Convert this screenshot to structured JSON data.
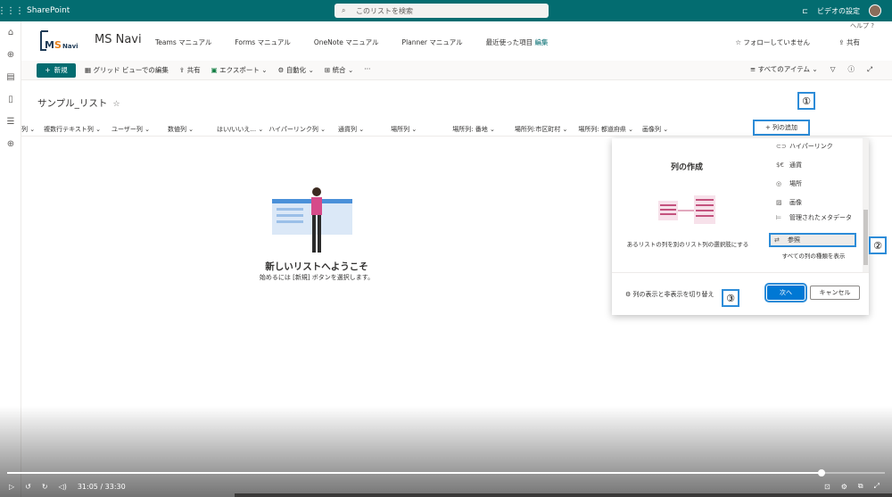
{
  "suite": {
    "app_name": "SharePoint",
    "search_placeholder": "このリストを検索",
    "video_settings": "ビデオの設定"
  },
  "site": {
    "logo_text": "MS Navi",
    "title": "MS Navi",
    "nav": [
      "Teams マニュアル",
      "Forms マニュアル",
      "OneNote マニュアル",
      "Planner マニュアル",
      "最近使った項目"
    ],
    "edit_link": "編集",
    "help": "ヘルプ",
    "follow": "☆ フォローしていません",
    "share": "共有"
  },
  "commandbar": {
    "new": "新規",
    "items": [
      "グリッド ビューでの編集",
      "共有",
      "エクスポート",
      "自動化",
      "統合",
      "···"
    ],
    "view": "すべてのアイテム"
  },
  "list": {
    "title": "サンプル_リスト",
    "columns": [
      "列",
      "複数行テキスト列",
      "ユーザー列",
      "数値列",
      "はい/いいえ...",
      "ハイパーリンク列",
      "通貨列",
      "場所列",
      "場所列: 番地",
      "場所列:市区町村",
      "場所列: 都道府県",
      "画像列"
    ],
    "add_column": "+ 列の追加"
  },
  "empty": {
    "title": "新しいリストへようこそ",
    "subtitle": "始めるには [新規] ボタンを選択します。"
  },
  "panel": {
    "heading": "列の作成",
    "description": "あるリストの列を別のリスト列の選択肢にする",
    "options": [
      "ハイパーリンク",
      "通貨",
      "場所",
      "画像",
      "管理されたメタデータ",
      "参照"
    ],
    "all_types": "すべての列の種類を表示",
    "toggle_link": "列の表示と非表示を切り替え",
    "next": "次へ",
    "cancel": "キャンセル"
  },
  "callouts": [
    "①",
    "②",
    "③"
  ],
  "player": {
    "time": "31:05 / 33:30",
    "progress_fraction": 0.928
  },
  "colors": {
    "suite_bar": "#036c70",
    "accent": "#0078d4",
    "callout_border": "#2d8cd8"
  }
}
